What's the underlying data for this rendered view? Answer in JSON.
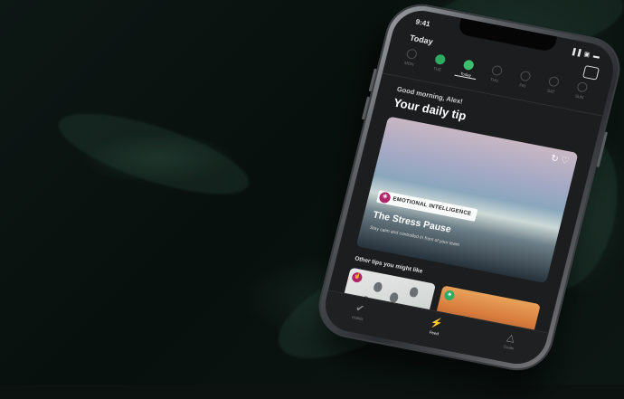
{
  "status_bar": {
    "time": "9:41",
    "icons": "▐▐ ▣ ▬"
  },
  "header": {
    "title": "Today",
    "share_icon": "share-icon"
  },
  "week": {
    "days": [
      {
        "label": "MON",
        "state": "empty"
      },
      {
        "label": "TUE",
        "state": "done"
      },
      {
        "label": "Today",
        "state": "today"
      },
      {
        "label": "THU",
        "state": "empty"
      },
      {
        "label": "FRI",
        "state": "empty"
      },
      {
        "label": "SAT",
        "state": "empty"
      },
      {
        "label": "SUN",
        "state": "empty"
      }
    ]
  },
  "greeting": "Good morning, Alex!",
  "headline": "Your daily tip",
  "tip": {
    "category": "EMOTIONAL INTELLIGENCE",
    "title": "The Stress Pause",
    "subtitle": "Stay calm and controlled in front of your team",
    "category_color": "#b2246a"
  },
  "other_tips_heading": "Other tips you might like",
  "tabs": [
    {
      "label": "Habits",
      "icon": "check-circle-icon",
      "active": false
    },
    {
      "label": "Feed",
      "icon": "lightning-icon",
      "active": true
    },
    {
      "label": "Goals",
      "icon": "mountain-icon",
      "active": false
    }
  ],
  "colors": {
    "accent_green": "#3cc070",
    "tab_bar": "#1e2021"
  }
}
